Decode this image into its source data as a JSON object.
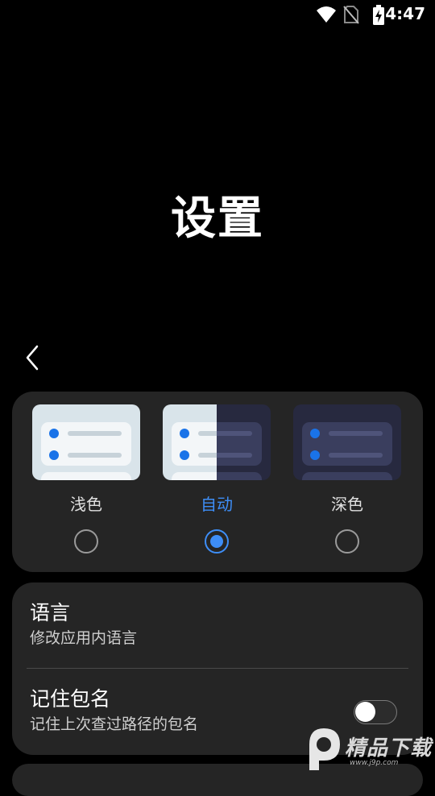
{
  "status_bar": {
    "time": "4:47",
    "icons": [
      "wifi-icon",
      "no-sim-icon",
      "battery-charging-icon"
    ]
  },
  "page": {
    "title": "设置"
  },
  "theme": {
    "options": [
      {
        "label": "浅色",
        "selected": false
      },
      {
        "label": "自动",
        "selected": true
      },
      {
        "label": "深色",
        "selected": false
      }
    ],
    "accent_color": "#3e8ef7"
  },
  "settings": {
    "language": {
      "title": "语言",
      "subtitle": "修改应用内语言"
    },
    "remember_package": {
      "title": "记住包名",
      "subtitle": "记住上次查过路径的包名",
      "toggle_on": false
    }
  },
  "watermark": {
    "text": "精品下载",
    "url": "www.j9p.com"
  }
}
